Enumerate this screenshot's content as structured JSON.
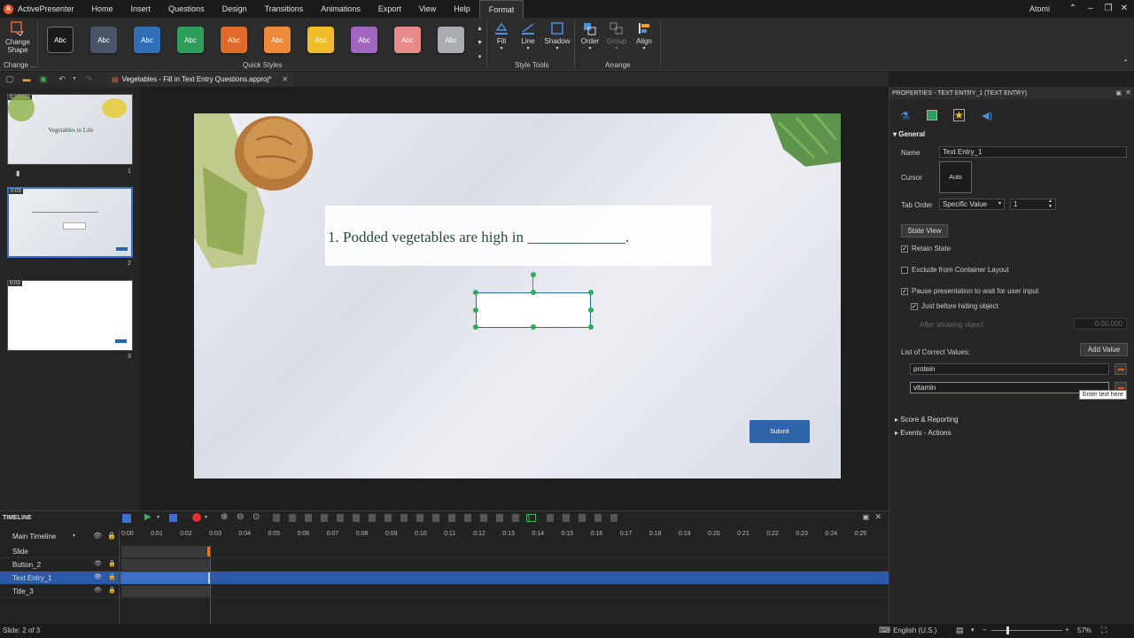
{
  "app": {
    "name": "ActivePresenter",
    "user": "Atomi"
  },
  "menu": [
    "Home",
    "Insert",
    "Questions",
    "Design",
    "Transitions",
    "Animations",
    "Export",
    "View",
    "Help",
    "Format"
  ],
  "ribbon": {
    "change_shape": "Change\nShape",
    "change_group": "Change ...",
    "quick_styles_label": "Quick Styles",
    "quick_styles": [
      {
        "label": "Abc",
        "color": "#1a1a1a"
      },
      {
        "label": "Abc",
        "color": "#4a5668"
      },
      {
        "label": "Abc",
        "color": "#2f6fb8"
      },
      {
        "label": "Abc",
        "color": "#2f9e5a"
      },
      {
        "label": "Abc",
        "color": "#e06a2a"
      },
      {
        "label": "Abc",
        "color": "#ef8a3a"
      },
      {
        "label": "Abc",
        "color": "#f0bc2a"
      },
      {
        "label": "Abc",
        "color": "#a267c0"
      },
      {
        "label": "Abc",
        "color": "#e88a8a"
      },
      {
        "label": "Abc",
        "color": "#a9adb2"
      }
    ],
    "style_tools": [
      "Fill",
      "Line",
      "Shadow"
    ],
    "style_tools_label": "Style Tools",
    "arrange": [
      "Order",
      "Group",
      "Align"
    ],
    "arrange_label": "Arrange"
  },
  "doc_tab": "Vegetables - Fill in Text Entry Questions.approj*",
  "slides": [
    {
      "time": "0:10.001",
      "number": "1",
      "title": "Vegetables in Life"
    },
    {
      "time": "0:03",
      "number": "2"
    },
    {
      "time": "0:03",
      "number": "3"
    }
  ],
  "slide": {
    "question": "1. Podded vegetables are high in _____________.",
    "submit": "Submit"
  },
  "properties": {
    "title": "PROPERTIES - TEXT ENTRY_1 (TEXT ENTRY)",
    "general": "General",
    "name_label": "Name",
    "name_value": "Text Entry_1",
    "cursor_label": "Cursor",
    "cursor_value": "Auto",
    "tab_order_label": "Tab Order",
    "tab_order_mode": "Specific Value",
    "tab_order_value": "1",
    "state_view": "State View",
    "retain_state": "Retain State",
    "exclude_layout": "Exclude from Container Layout",
    "pause_presentation": "Pause presentation to wait for user input",
    "just_before_hiding": "Just before hiding object",
    "after_showing": "After showing object",
    "after_showing_value": "0:00.000",
    "correct_values_label": "List of Correct Values:",
    "add_value": "Add Value",
    "correct_values": [
      "protein",
      "vitamin"
    ],
    "tooltip": "Enter text here",
    "score_reporting": "Score & Reporting",
    "events_actions": "Events - Actions"
  },
  "timeline": {
    "title": "TIMELINE",
    "main_timeline": "Main Timeline",
    "ticks": [
      "0:00",
      "0:01",
      "0:02",
      "0:03",
      "0:04",
      "0:05",
      "0:06",
      "0:07",
      "0:08",
      "0:09",
      "0:10",
      "0:11",
      "0:12",
      "0:13",
      "0:14",
      "0:15",
      "0:16",
      "0:17",
      "0:18",
      "0:19",
      "0:20",
      "0:21",
      "0:22",
      "0:23",
      "0:24",
      "0:25"
    ],
    "rows": [
      "Slide",
      "Button_2",
      "Text Entry_1",
      "Title_3"
    ]
  },
  "status": {
    "slide": "Slide: 2 of 3",
    "language": "English (U.S.)",
    "zoom": "57%"
  }
}
